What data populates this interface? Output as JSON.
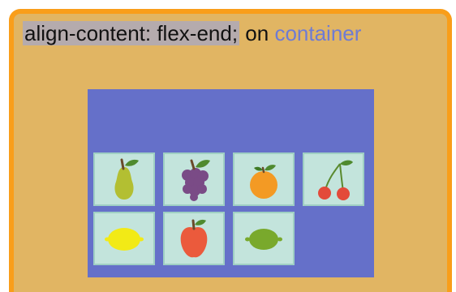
{
  "caption": {
    "code_text": "align-content: flex-end;",
    "on_text": "on",
    "link_text": "container"
  },
  "colors": {
    "frame_border": "#f99e1a",
    "frame_bg": "#e1b563",
    "container_bg": "#6570c9",
    "item_bg": "#c3e4dc",
    "code_highlight": "#b5abad",
    "link_color": "#6e7bd4"
  },
  "items": [
    {
      "name": "pear-icon"
    },
    {
      "name": "grapes-icon"
    },
    {
      "name": "orange-icon"
    },
    {
      "name": "cherries-icon"
    },
    {
      "name": "lemon-icon"
    },
    {
      "name": "apple-icon"
    },
    {
      "name": "lime-icon"
    }
  ]
}
